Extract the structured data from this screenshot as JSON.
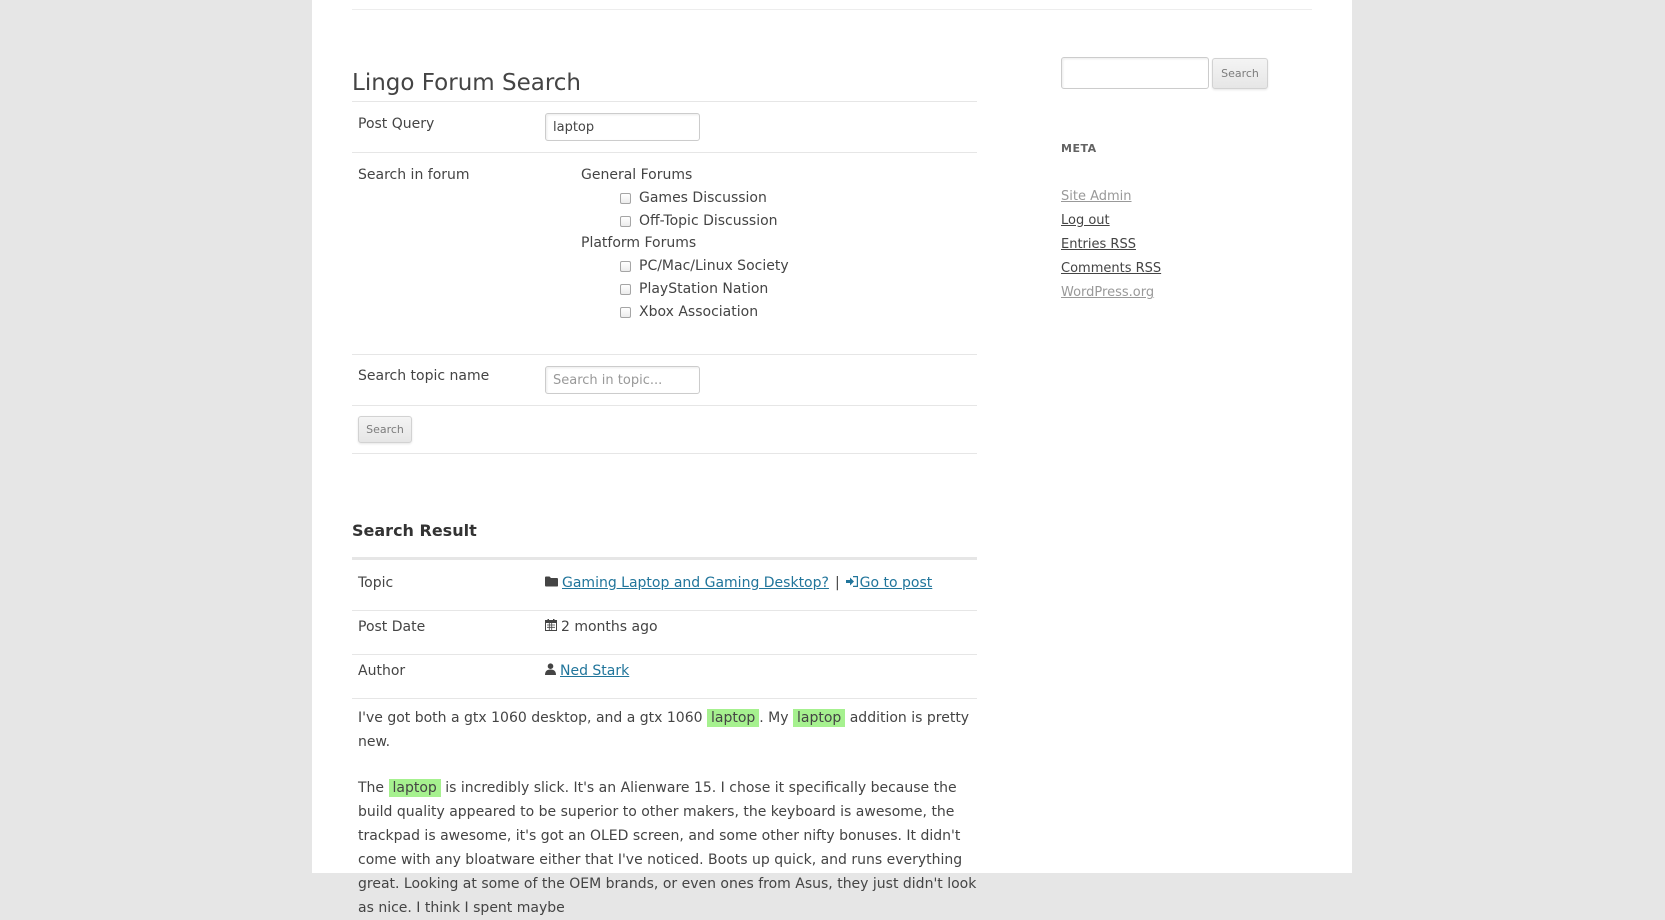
{
  "main": {
    "title": "Lingo Forum Search",
    "post_query": {
      "label": "Post Query",
      "value": "laptop"
    },
    "search_in_forum": {
      "label": "Search in forum",
      "groups": [
        {
          "name": "General Forums",
          "forums": [
            "Games Discussion",
            "Off-Topic Discussion"
          ]
        },
        {
          "name": "Platform Forums",
          "forums": [
            "PC/Mac/Linux Society",
            "PlayStation Nation",
            "Xbox Association"
          ]
        }
      ]
    },
    "topic_search": {
      "label": "Search topic name",
      "placeholder": "Search in topic..."
    },
    "search_button": "Search"
  },
  "results": {
    "heading": "Search Result",
    "topic_label": "Topic",
    "topic_link": "Gaming Laptop and Gaming Desktop?",
    "separator": "|",
    "go_to_post": "Go to post",
    "date_label": "Post Date",
    "date_value": "2 months ago",
    "author_label": "Author",
    "author_value": "Ned Stark",
    "highlight_term": "laptop",
    "para1": {
      "a": "I've got both a gtx 1060 desktop, and a gtx 1060 ",
      "b": ". My ",
      "c": " addition is pretty new."
    },
    "para2": {
      "a": "The ",
      "b": " is incredibly slick. It's an Alienware 15. I chose it specifically because the build quality appeared to be superior to other makers, the keyboard is awesome, the trackpad is awesome, it's got an OLED screen, and some other nifty bonuses. It didn't come with any bloatware either that I've noticed. Boots up quick, and runs everything great. Looking at some of the OEM brands, or even ones from Asus, they just didn't look as nice. I think I spent maybe"
    }
  },
  "sidebar": {
    "search_button": "Search",
    "meta_heading": "META",
    "links": [
      {
        "label": "Site Admin",
        "color": "#999999"
      },
      {
        "label": "Log out",
        "color": "#444444"
      },
      {
        "label": "Entries RSS",
        "color": "#444444"
      },
      {
        "label": "Comments RSS",
        "color": "#444444"
      },
      {
        "label": "WordPress.org",
        "color": "#999999"
      }
    ]
  },
  "colors": {
    "link": "#21759b",
    "highlight": "#a6f18f",
    "background": "#e6e6e6"
  },
  "icons": {
    "topic": "folder-icon",
    "go_to_post": "sign-in-icon",
    "date": "calendar-icon",
    "author": "user-icon"
  }
}
